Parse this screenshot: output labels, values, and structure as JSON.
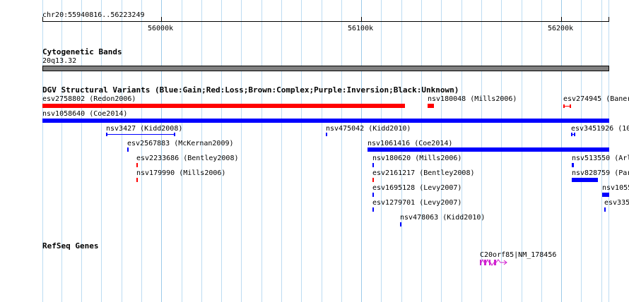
{
  "browser": {
    "position_label": "chr20:55940816..56223249",
    "scale_ticks": [
      {
        "label": "56000k"
      },
      {
        "label": "56100k"
      },
      {
        "label": "56200k"
      }
    ]
  },
  "tracks": {
    "cytoband": {
      "title": "Cytogenetic Bands",
      "band_label": "20q13.32"
    },
    "dgv": {
      "title": "DGV Structural Variants (Blue:Gain;Red:Loss;Brown:Complex;Purple:Inversion;Black:Unknown)",
      "features": [
        {
          "label": "esv2758802 (Redon2006)",
          "type": "loss"
        },
        {
          "label": "nsv180048 (Mills2006)",
          "type": "loss"
        },
        {
          "label": "esv274945 (Baner",
          "type": "loss"
        },
        {
          "label": "nsv1058640 (Coe2014)",
          "type": "gain"
        },
        {
          "label": "nsv3427 (Kidd2008)",
          "type": "gain"
        },
        {
          "label": "nsv475042 (Kidd2010)",
          "type": "gain"
        },
        {
          "label": "esv3451926 (10",
          "type": "gain"
        },
        {
          "label": "esv2567883 (McKernan2009)",
          "type": "gain"
        },
        {
          "label": "nsv1061416 (Coe2014)",
          "type": "gain"
        },
        {
          "label": "esv2233686 (Bentley2008)",
          "type": "loss"
        },
        {
          "label": "nsv180620 (Mills2006)",
          "type": "gain"
        },
        {
          "label": "nsv513550 (Arl",
          "type": "gain"
        },
        {
          "label": "nsv179990 (Mills2006)",
          "type": "loss"
        },
        {
          "label": "esv2161217 (Bentley2008)",
          "type": "loss"
        },
        {
          "label": "nsv828759 (Par",
          "type": "gain"
        },
        {
          "label": "esv1695128 (Levy2007)",
          "type": "gain"
        },
        {
          "label": "nsv1055",
          "type": "gain"
        },
        {
          "label": "esv1279701 (Levy2007)",
          "type": "gain"
        },
        {
          "label": "esv335",
          "type": "gain"
        },
        {
          "label": "nsv478063 (Kidd2010)",
          "type": "gain"
        }
      ]
    },
    "refseq": {
      "title": "RefSeq Genes",
      "gene_label": "C20orf85|NM_178456"
    }
  },
  "colors": {
    "gain": "#0000ff",
    "loss": "#ff0000",
    "gene": "#d020d0",
    "grid": "#bcdcf2"
  }
}
